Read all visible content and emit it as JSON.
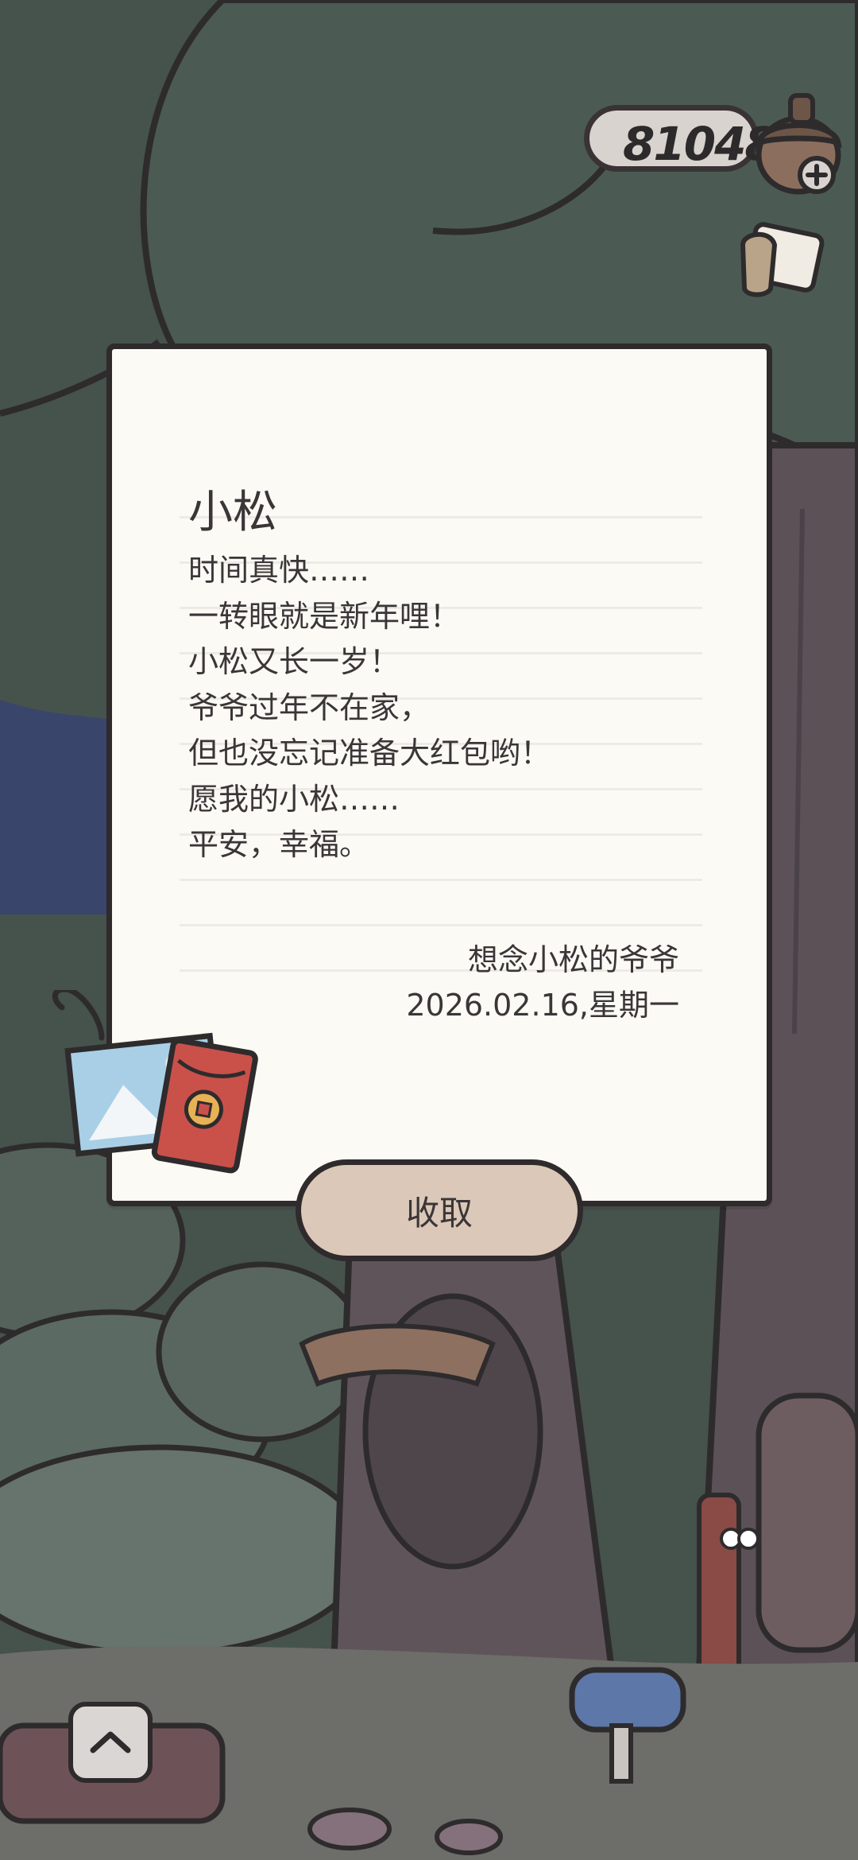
{
  "currency": {
    "amount": "81048",
    "icon": "acorn-icon",
    "add_icon": "plus-icon"
  },
  "letter": {
    "recipient": "小松",
    "body": [
      "时间真快……",
      "一转眼就是新年哩！",
      "小松又长一岁！",
      "爷爷过年不在家，",
      "但也没忘记准备大红包哟！",
      "愿我的小松……",
      "平安，幸福。"
    ],
    "signature": "想念小松的爷爷",
    "date": "2026.02.16,星期一"
  },
  "actions": {
    "collect_label": "收取"
  },
  "icons": {
    "attachment": "photo-and-red-envelope-icon",
    "expand": "chevron-up-icon",
    "mailbox": "mailbox-icon",
    "letter_toggle": "letter-icon"
  },
  "colors": {
    "background": "#3b4a44",
    "card": "#fbfaf5",
    "button": "#dcc8b8",
    "red_envelope": "#c9514a"
  }
}
